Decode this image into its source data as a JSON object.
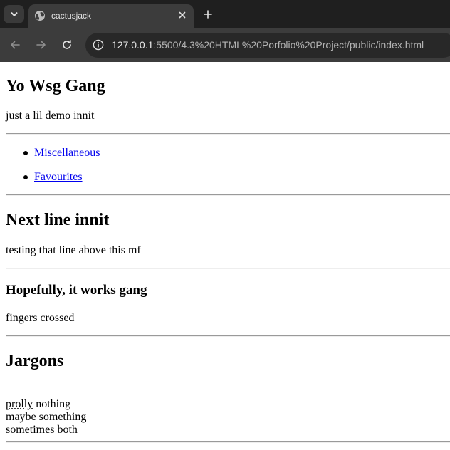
{
  "browser": {
    "tab": {
      "title": "cactusjack"
    },
    "address": {
      "host": "127.0.0.1",
      "rest": ":5500/4.3%20HTML%20Porfolio%20Project/public/index.html"
    },
    "icons": {
      "tab_search": "chevron-down-icon",
      "favicon": "globe-icon",
      "close": "close-icon",
      "new_tab": "plus-icon",
      "back": "arrow-left-icon",
      "forward": "arrow-right-icon",
      "reload": "reload-icon",
      "site_info": "info-icon"
    }
  },
  "page": {
    "title": "Yo Wsg Gang",
    "subtitle": "just a lil demo innit",
    "nav": [
      {
        "label": "Miscellaneous"
      },
      {
        "label": "Favourites"
      }
    ],
    "section1": {
      "heading": "Next line innit",
      "text": "testing that line above this mf"
    },
    "section2": {
      "heading": "Hopefully, it works gang",
      "text": "fingers crossed"
    },
    "section3": {
      "heading": "Jargons",
      "lines": [
        {
          "abbr": "prolly",
          "rest": " nothing"
        },
        {
          "text": "maybe something"
        },
        {
          "text": "sometimes both"
        }
      ]
    }
  }
}
